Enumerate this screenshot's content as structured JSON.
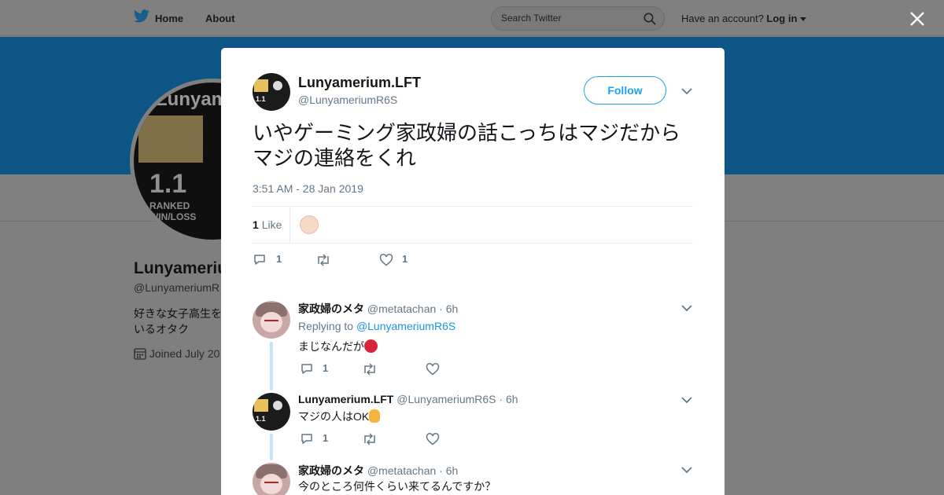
{
  "topbar": {
    "home_label": "Home",
    "about_label": "About",
    "search_placeholder": "Search Twitter",
    "have_account": "Have an account?",
    "login_label": "Log in"
  },
  "background_profile": {
    "avatar_title": "Lunyameri",
    "avatar_num": "1.1",
    "avatar_sub1": "RANKED",
    "avatar_sub2": "WIN/LOSS",
    "name": "Lunyamerium",
    "handle": "@LunyameriumR",
    "bio_line1": "好きな女子高生を",
    "bio_line2": "いるオタク",
    "joined": "Joined July 20"
  },
  "tweet": {
    "author_name": "Lunyamerium.LFT",
    "author_handle": "@LunyameriumR6S",
    "follow_label": "Follow",
    "text": "いやゲーミング家政婦の話こっちはマジだからマジの連絡をくれ",
    "timestamp": "3:51 AM - 28 Jan 2019",
    "likes_count": "1",
    "likes_label": "Like",
    "reply_count": "1",
    "like_count_action": "1"
  },
  "replies": [
    {
      "name": "家政婦のメタ",
      "handle": "@metatachan",
      "time": "· 6h",
      "replying_prefix": "Replying to",
      "replying_to": "@LunyameriumR6S",
      "text": "まじなんだが",
      "reply_count": "1"
    },
    {
      "name": "Lunyamerium.LFT",
      "handle": "@LunyameriumR6S",
      "time": "· 6h",
      "text": "マジの人はOK",
      "reply_count": "1"
    },
    {
      "name": "家政婦のメタ",
      "handle": "@metatachan",
      "time": "· 6h",
      "text": "今のところ何件くらい来てるんですか？"
    }
  ],
  "colors": {
    "twitter_blue": "#1da1f2",
    "banner": "#0c5585",
    "overlay_gray": "#7f7f7f"
  }
}
